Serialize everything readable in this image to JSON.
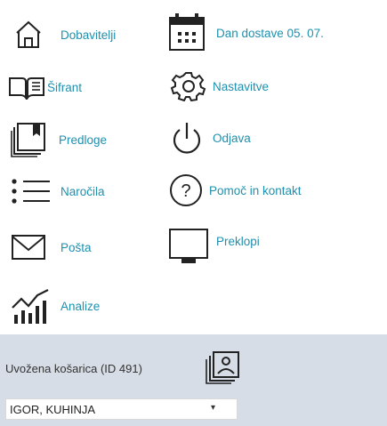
{
  "menu": {
    "suppliers": "Dobavitelji",
    "catalog": "Šifrant",
    "templates": "Predloge",
    "orders": "Naročila",
    "mail": "Pošta",
    "analytics": "Analize",
    "delivery_date": "Dan dostave 05. 07.",
    "settings": "Nastavitve",
    "logout": "Odjava",
    "help": "Pomoč in kontakt",
    "switch": "Preklopi"
  },
  "footer": {
    "basket_label": "Uvožena košarica (ID 491)",
    "selected_location": "IGOR, KUHINJA"
  },
  "colors": {
    "accent": "#1f90ad",
    "footer_bg": "#d7dde6"
  }
}
